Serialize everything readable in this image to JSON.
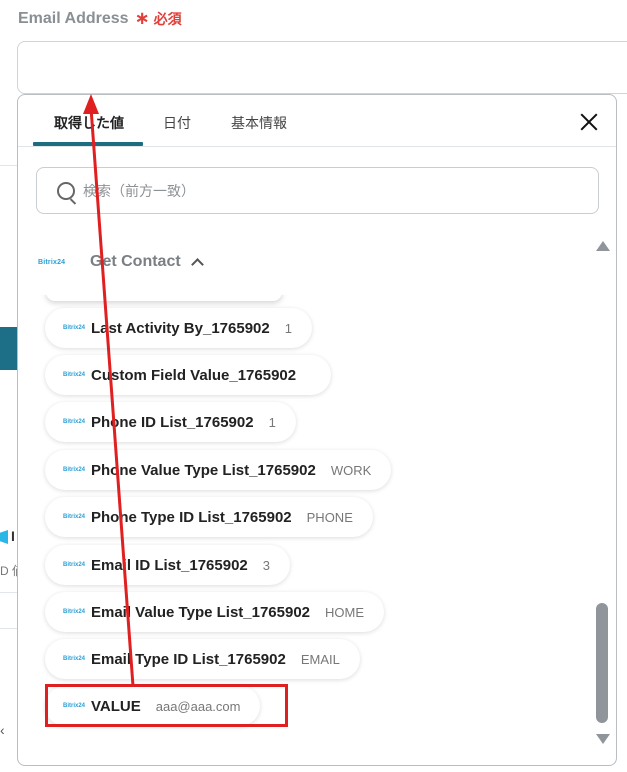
{
  "field": {
    "label": "Email Address",
    "required_star": "∗",
    "required_text": "必須",
    "value": ""
  },
  "background": {
    "fragment_text1": "I",
    "fragment_text2": "D 値"
  },
  "popup": {
    "tabs": [
      {
        "label": "取得した値",
        "active": true
      },
      {
        "label": "日付",
        "active": false
      },
      {
        "label": "基本情報",
        "active": false
      }
    ],
    "search_placeholder": "検索（前方一致）",
    "group": {
      "logo_text": "Bitrix24",
      "title": "Get Contact",
      "expanded": true
    },
    "items": [
      {
        "label": "Last Activity By_1765902",
        "value": "1"
      },
      {
        "label": "Custom Field Value_1765902",
        "value": ""
      },
      {
        "label": "Phone ID List_1765902",
        "value": "1"
      },
      {
        "label": "Phone Value Type List_1765902",
        "value": "WORK"
      },
      {
        "label": "Phone Type ID List_1765902",
        "value": "PHONE"
      },
      {
        "label": "Email ID List_1765902",
        "value": "3"
      },
      {
        "label": "Email Value Type List_1765902",
        "value": "HOME"
      },
      {
        "label": "Email Type ID List_1765902",
        "value": "EMAIL"
      },
      {
        "label": "VALUE",
        "value": "aaa@aaa.com",
        "highlighted": true
      }
    ]
  },
  "colors": {
    "accent": "#1c6d80",
    "required": "#e0403a",
    "annotation": "#e02020",
    "brand_logo": "#2a9fd6"
  }
}
